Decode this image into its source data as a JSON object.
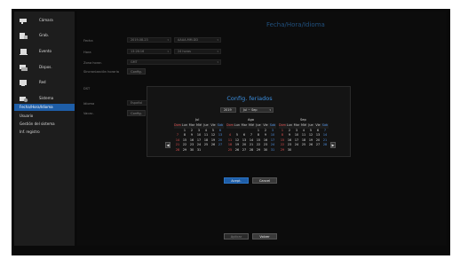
{
  "sidebar": {
    "items": [
      {
        "label": "Cámara",
        "icon": "camera-icon"
      },
      {
        "label": "Grab.",
        "icon": "record-icon"
      },
      {
        "label": "Evento",
        "icon": "event-icon"
      },
      {
        "label": "Dispos.",
        "icon": "device-icon"
      },
      {
        "label": "Red",
        "icon": "network-icon"
      },
      {
        "label": "Sistema",
        "icon": "system-icon"
      }
    ],
    "subitems": [
      {
        "label": "Fecha/Hora/Idioma",
        "active": true
      },
      {
        "label": "Usuario",
        "active": false
      },
      {
        "label": "Gestión del sistema",
        "active": false
      },
      {
        "label": "Inf. registro",
        "active": false
      }
    ]
  },
  "page": {
    "title": "Fecha/Hora/Idioma"
  },
  "form": {
    "fecha_label": "Fecha",
    "fecha_value": "2019-08-23",
    "fecha_format": "AAAA-MM-DD",
    "hora_label": "Hora",
    "hora_value": "13:26:16",
    "hora_format": "24 horas",
    "zona_label": "Zona horar.",
    "zona_value": "GMT",
    "sync_label": "Sincronización horaria",
    "sync_button": "Config.",
    "dst_label": "DST",
    "idioma_label": "Idioma",
    "idioma_value": "Español",
    "vacac_label": "Vacac.",
    "vacac_button": "Config."
  },
  "dialog": {
    "title": "Config. feriados",
    "year": "2019",
    "range": "Jul ~ Sep",
    "weekdays": [
      "Dom",
      "Lun",
      "Mar",
      "Mié",
      "Jue",
      "Vie",
      "Sab"
    ],
    "months": [
      {
        "name": "Jul",
        "weeks": [
          [
            "",
            "1",
            "2",
            "3",
            "4",
            "5",
            "6"
          ],
          [
            "7",
            "8",
            "9",
            "10",
            "11",
            "12",
            "13"
          ],
          [
            "14",
            "15",
            "16",
            "17",
            "18",
            "19",
            "20"
          ],
          [
            "21",
            "22",
            "23",
            "24",
            "25",
            "26",
            "27"
          ],
          [
            "28",
            "29",
            "30",
            "31",
            "",
            "",
            ""
          ]
        ]
      },
      {
        "name": "Ago",
        "weeks": [
          [
            "",
            "",
            "",
            "",
            "1",
            "2",
            "3"
          ],
          [
            "4",
            "5",
            "6",
            "7",
            "8",
            "9",
            "10"
          ],
          [
            "11",
            "12",
            "13",
            "14",
            "15",
            "16",
            "17"
          ],
          [
            "18",
            "19",
            "20",
            "21",
            "22",
            "23",
            "24"
          ],
          [
            "25",
            "26",
            "27",
            "28",
            "29",
            "30",
            "31"
          ]
        ]
      },
      {
        "name": "Sep",
        "weeks": [
          [
            "1",
            "2",
            "3",
            "4",
            "5",
            "6",
            "7"
          ],
          [
            "8",
            "9",
            "10",
            "11",
            "12",
            "13",
            "14"
          ],
          [
            "15",
            "16",
            "17",
            "18",
            "19",
            "20",
            "21"
          ],
          [
            "22",
            "23",
            "24",
            "25",
            "26",
            "27",
            "28"
          ],
          [
            "29",
            "30",
            "",
            "",
            "",
            "",
            ""
          ]
        ]
      }
    ],
    "prev_label": "◀",
    "next_label": "▶",
    "accept_label": "Acept.",
    "cancel_label": "Cancel"
  },
  "footer": {
    "apply_label": "Aplicar",
    "back_label": "Volver"
  },
  "colors": {
    "accent": "#1e5ea8",
    "title": "#3b8fe0",
    "sunday": "#e05050",
    "saturday": "#4f8fe0"
  }
}
